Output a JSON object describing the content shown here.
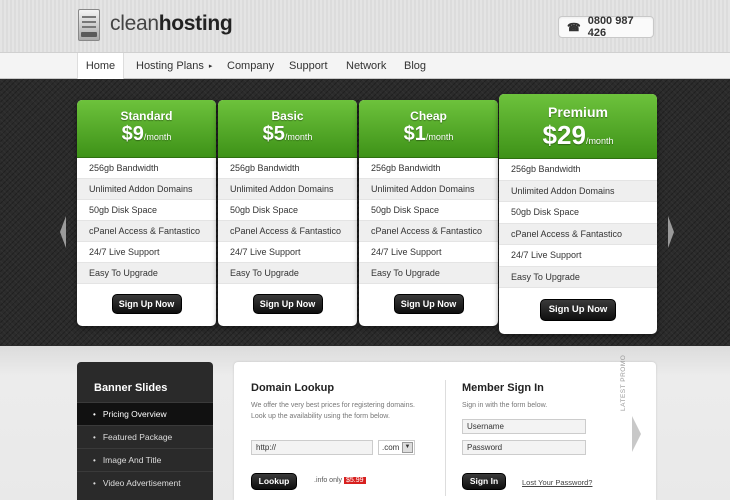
{
  "brand": {
    "name_light": "clean",
    "name_bold": "hosting",
    "phone": "0800 987 426"
  },
  "nav": {
    "items": [
      {
        "label": "Home",
        "active": true
      },
      {
        "label": "Hosting Plans",
        "arrow": "▸"
      },
      {
        "label": "Company"
      },
      {
        "label": "Support"
      },
      {
        "label": "Network"
      },
      {
        "label": "Blog"
      }
    ]
  },
  "plans": [
    {
      "name": "Standard",
      "currency": "$",
      "price": "9",
      "period": "/month",
      "features": [
        "256gb Bandwidth",
        "Unlimited Addon Domains",
        "50gb Disk Space",
        "cPanel Access & Fantastico",
        "24/7 Live Support",
        "Easy To Upgrade"
      ],
      "button": "Sign Up Now"
    },
    {
      "name": "Basic",
      "currency": "$",
      "price": "5",
      "period": "/month",
      "features": [
        "256gb Bandwidth",
        "Unlimited Addon Domains",
        "50gb Disk Space",
        "cPanel Access & Fantastico",
        "24/7 Live Support",
        "Easy To Upgrade"
      ],
      "button": "Sign Up Now"
    },
    {
      "name": "Cheap",
      "currency": "$",
      "price": "1",
      "period": "/month",
      "features": [
        "256gb Bandwidth",
        "Unlimited Addon Domains",
        "50gb Disk Space",
        "cPanel Access & Fantastico",
        "24/7 Live Support",
        "Easy To Upgrade"
      ],
      "button": "Sign Up Now"
    },
    {
      "name": "Premium",
      "currency": "$",
      "price": "29",
      "period": "/month",
      "featured": true,
      "features": [
        "256gb Bandwidth",
        "Unlimited Addon Domains",
        "50gb Disk Space",
        "cPanel Access & Fantastico",
        "24/7 Live Support",
        "Easy To Upgrade"
      ],
      "button": "Sign Up Now"
    }
  ],
  "banner": {
    "title": "Banner Slides",
    "items": [
      {
        "label": "Pricing Overview",
        "active": true
      },
      {
        "label": "Featured Package"
      },
      {
        "label": "Image And Title"
      },
      {
        "label": "Video Advertisement"
      }
    ]
  },
  "domain_lookup": {
    "title": "Domain Lookup",
    "desc_line1": "We offer the very best prices for registering domains.",
    "desc_line2": "Look up the availability using the form below.",
    "input_value": "http://",
    "tld": ".com",
    "button": "Lookup",
    "promo_text": ".info only",
    "promo_price": "$5.99"
  },
  "member": {
    "title": "Member Sign In",
    "desc": "Sign in with the form below.",
    "username": "Username",
    "password": "Password",
    "button": "Sign In",
    "lost_link": "Lost Your Password?"
  },
  "latest_promo": "LATEST PROMO",
  "colors": {
    "accent_green": "#4fa524",
    "dark": "#2a2a2a",
    "promo_red": "#d8201f"
  },
  "icons": [
    "server-icon",
    "phone-icon",
    "chevron-left-icon",
    "chevron-right-icon",
    "arrow-right-icon"
  ]
}
